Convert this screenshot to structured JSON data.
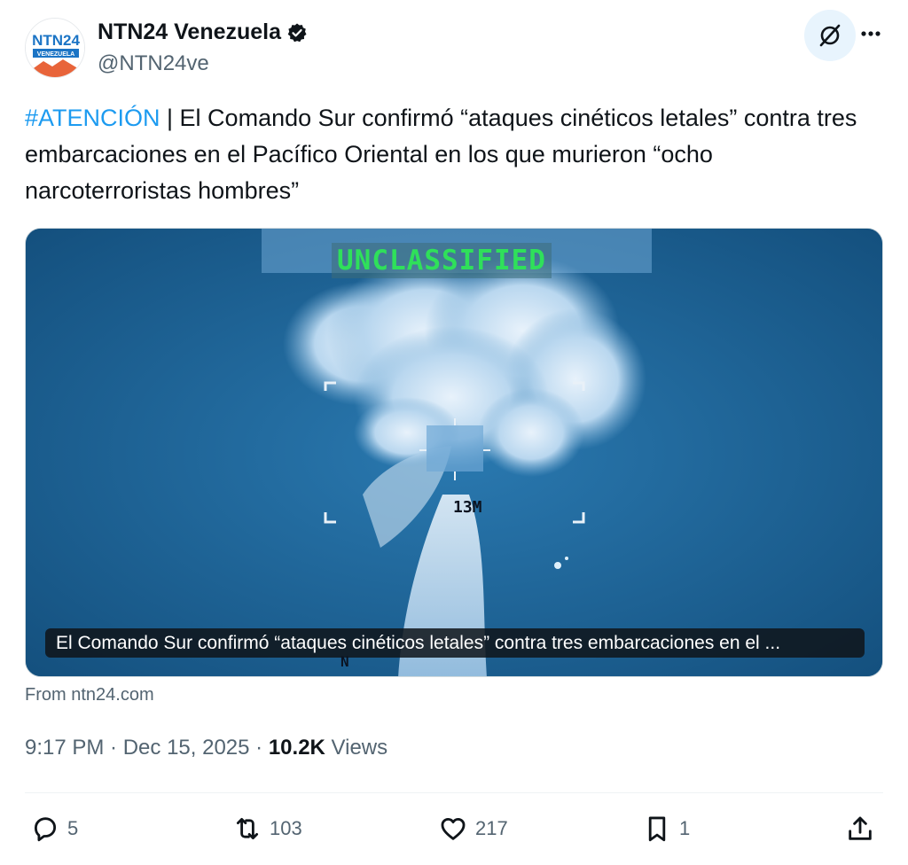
{
  "author": {
    "display_name": "NTN24 Venezuela",
    "handle": "@NTN24ve",
    "avatar_text": "NTN24",
    "avatar_subtext": "VENEZUELA",
    "verified_icon": "verified-badge-icon"
  },
  "header_actions": {
    "grok_icon": "grok-icon",
    "more_icon": "more-icon"
  },
  "post": {
    "hashtag": "#ATENCIÓN",
    "text": " | El Comando Sur confirmó “ataques cinéticos letales” contra tres embarcaciones en el Pacífico Oriental en los que murieron “ocho narcoterroristas hombres”"
  },
  "media": {
    "overlay_label": "UNCLASSIFIED",
    "range_label": "13M",
    "north_label": "N",
    "caption": "El Comando Sur confirmó “ataques cinéticos letales” contra tres embarcaciones en el ...",
    "source": "From ntn24.com"
  },
  "meta": {
    "time": "9:17 PM",
    "separator": " · ",
    "date": "Dec 15, 2025",
    "views_count": "10.2K",
    "views_label": " Views"
  },
  "actions": {
    "reply": "5",
    "repost": "103",
    "like": "217",
    "bookmark": "1"
  },
  "colors": {
    "accent": "#1d9bf0",
    "secondary_text": "#536471",
    "overlay_green": "#2fe05a"
  }
}
